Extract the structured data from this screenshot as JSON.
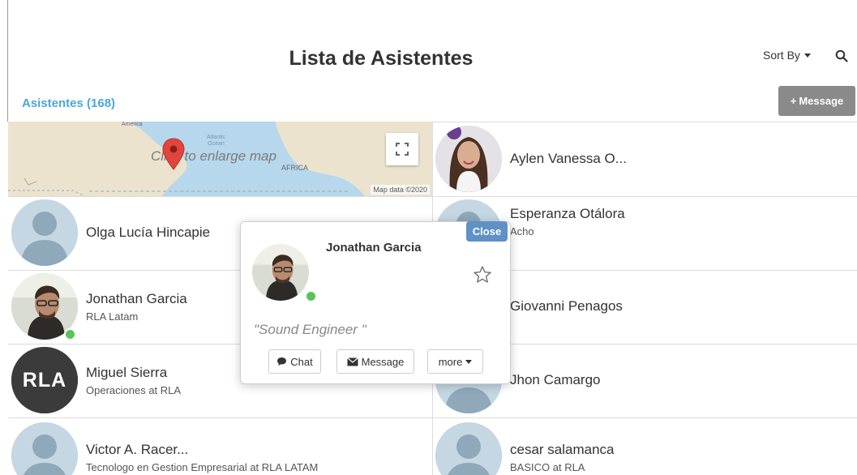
{
  "header": {
    "title": "Lista de Asistentes",
    "sort_label": "Sort By",
    "search_icon": "search-icon"
  },
  "toolbar": {
    "count_label": "Asistentes (168)",
    "message_button": "Message",
    "message_icon": "plus-icon"
  },
  "map": {
    "overlay_text": "Click to enlarge map",
    "region_label": "AFRICA",
    "ocean_label_1": "Atlantic",
    "ocean_label_2": "Ocean",
    "continent_label": "America",
    "credit": "Map data ©2020",
    "icons": [
      "fullscreen-icon",
      "map-pin-icon"
    ]
  },
  "attendees_left": [
    {
      "name": "Olga Lucía Hincapie",
      "subtitle": "",
      "avatar": "placeholder"
    },
    {
      "name": "Jonathan Garcia",
      "subtitle": "RLA Latam",
      "avatar": "photo",
      "online": true
    },
    {
      "name": "Miguel Sierra",
      "subtitle": "Operaciones at RLA",
      "avatar": "logo",
      "logo_text": "RLA"
    },
    {
      "name": "Victor A. Racer...",
      "subtitle": "Tecnologo en Gestion Empresarial at RLA LATAM",
      "avatar": "placeholder"
    }
  ],
  "attendees_right": [
    {
      "name": "Aylen Vanessa O...",
      "subtitle": "",
      "avatar": "photo"
    },
    {
      "name": "Esperanza Otálora",
      "subtitle": "Acho",
      "avatar": "placeholder"
    },
    {
      "name": "Giovanni Penagos",
      "subtitle": "",
      "avatar": "placeholder"
    },
    {
      "name": "Jhon Camargo",
      "subtitle": "",
      "avatar": "placeholder"
    },
    {
      "name": "cesar salamanca",
      "subtitle": "BASICO at RLA",
      "avatar": "placeholder"
    }
  ],
  "popup": {
    "close_label": "Close",
    "name": "Jonathan Garcia",
    "quote": "\"Sound Engineer \"",
    "chat_label": "Chat",
    "message_label": "Message",
    "more_label": "more",
    "icons": [
      "star-icon",
      "chat-icon",
      "envelope-icon",
      "chevron-down-icon"
    ]
  },
  "colors": {
    "accent": "#4aa7d8",
    "close_button": "#5f90c6",
    "message_button": "#8a8a8a",
    "online": "#5cc25c",
    "map_water": "#b6d7ec",
    "map_land": "#ece3cf",
    "pin": "#e0463d"
  }
}
